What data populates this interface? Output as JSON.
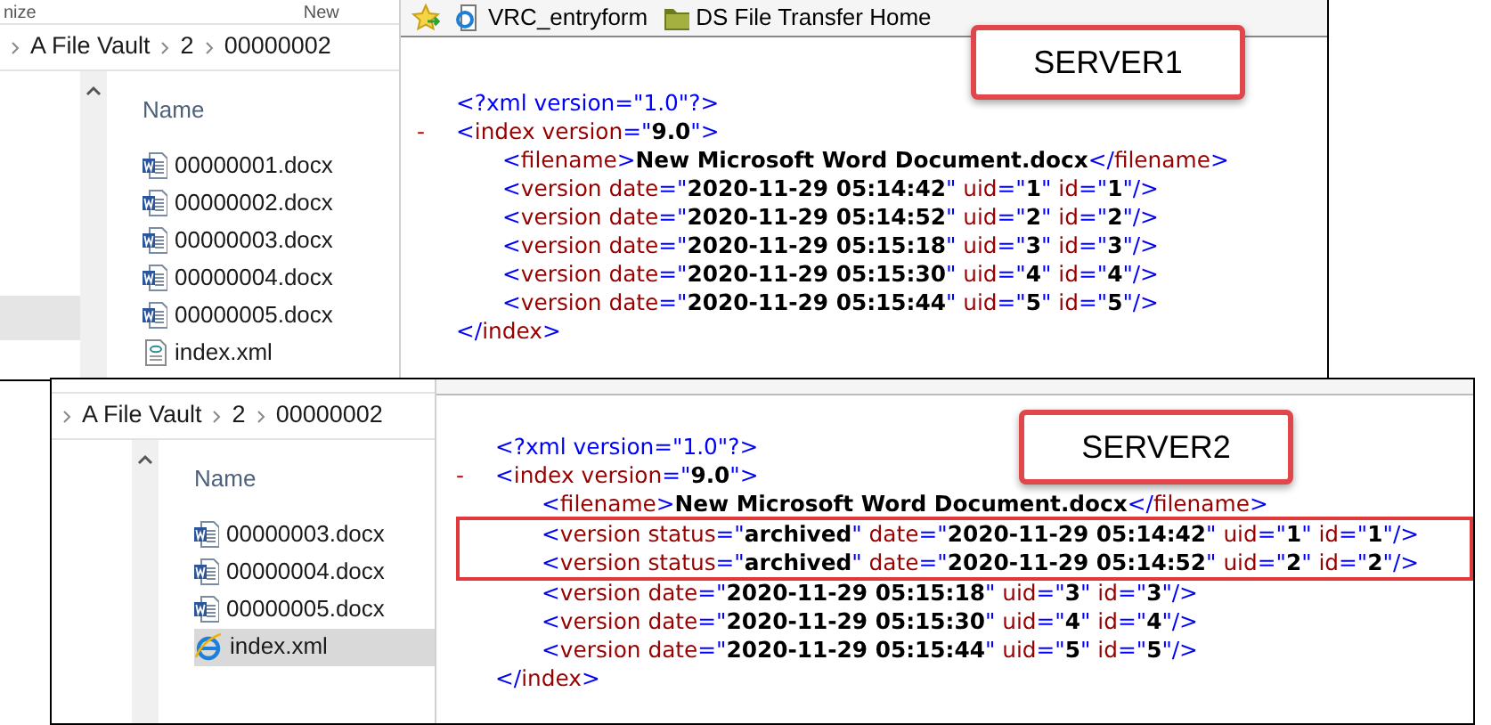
{
  "windows": [
    {
      "label": "SERVER1",
      "explorer": {
        "ribbon": [
          "nize",
          "New"
        ],
        "breadcrumb": [
          "A File Vault",
          "2",
          "00000002"
        ],
        "column": "Name",
        "files": [
          {
            "name": "00000001.docx",
            "kind": "word",
            "selected": false
          },
          {
            "name": "00000002.docx",
            "kind": "word",
            "selected": false
          },
          {
            "name": "00000003.docx",
            "kind": "word",
            "selected": false
          },
          {
            "name": "00000004.docx",
            "kind": "word",
            "selected": false
          },
          {
            "name": "00000005.docx",
            "kind": "word",
            "selected": false
          },
          {
            "name": "index.xml",
            "kind": "xml",
            "selected": false
          }
        ]
      },
      "favorites": [
        {
          "label": "VRC_entryform",
          "kind": "page"
        },
        {
          "label": "DS File Transfer Home",
          "kind": "folder"
        }
      ],
      "xml": [
        {
          "segments": [
            {
              "kind": "punct",
              "text": "<?"
            },
            {
              "kind": "punct",
              "text": "xml version=\"1.0\""
            },
            {
              "kind": "punct",
              "text": "?>"
            }
          ]
        },
        {
          "toggle": "-",
          "segments": [
            {
              "kind": "punct",
              "text": "<"
            },
            {
              "kind": "tag",
              "text": "index "
            },
            {
              "kind": "attr",
              "text": "version"
            },
            {
              "kind": "punct",
              "text": "=\""
            },
            {
              "kind": "value",
              "text": "9.0"
            },
            {
              "kind": "punct",
              "text": "\">"
            }
          ],
          "children": [
            {
              "segments": [
                {
                  "kind": "punct",
                  "text": "<"
                },
                {
                  "kind": "tag",
                  "text": "filename"
                },
                {
                  "kind": "punct",
                  "text": ">"
                },
                {
                  "kind": "value",
                  "text": "New Microsoft Word Document.docx"
                },
                {
                  "kind": "punct",
                  "text": "</"
                },
                {
                  "kind": "tag",
                  "text": "filename"
                },
                {
                  "kind": "punct",
                  "text": ">"
                }
              ],
              "highlighted": false
            },
            {
              "segments": [
                {
                  "kind": "punct",
                  "text": "<"
                },
                {
                  "kind": "tag",
                  "text": "version "
                },
                {
                  "kind": "attr",
                  "text": "date"
                },
                {
                  "kind": "punct",
                  "text": "=\""
                },
                {
                  "kind": "value",
                  "text": "2020-11-29 05:14:42"
                },
                {
                  "kind": "punct",
                  "text": "\" "
                },
                {
                  "kind": "attr",
                  "text": "uid"
                },
                {
                  "kind": "punct",
                  "text": "=\""
                },
                {
                  "kind": "value",
                  "text": "1"
                },
                {
                  "kind": "punct",
                  "text": "\" "
                },
                {
                  "kind": "attr",
                  "text": "id"
                },
                {
                  "kind": "punct",
                  "text": "=\""
                },
                {
                  "kind": "value",
                  "text": "1"
                },
                {
                  "kind": "punct",
                  "text": "\"/>"
                }
              ],
              "highlighted": false
            },
            {
              "segments": [
                {
                  "kind": "punct",
                  "text": "<"
                },
                {
                  "kind": "tag",
                  "text": "version "
                },
                {
                  "kind": "attr",
                  "text": "date"
                },
                {
                  "kind": "punct",
                  "text": "=\""
                },
                {
                  "kind": "value",
                  "text": "2020-11-29 05:14:52"
                },
                {
                  "kind": "punct",
                  "text": "\" "
                },
                {
                  "kind": "attr",
                  "text": "uid"
                },
                {
                  "kind": "punct",
                  "text": "=\""
                },
                {
                  "kind": "value",
                  "text": "2"
                },
                {
                  "kind": "punct",
                  "text": "\" "
                },
                {
                  "kind": "attr",
                  "text": "id"
                },
                {
                  "kind": "punct",
                  "text": "=\""
                },
                {
                  "kind": "value",
                  "text": "2"
                },
                {
                  "kind": "punct",
                  "text": "\"/>"
                }
              ],
              "highlighted": false
            },
            {
              "segments": [
                {
                  "kind": "punct",
                  "text": "<"
                },
                {
                  "kind": "tag",
                  "text": "version "
                },
                {
                  "kind": "attr",
                  "text": "date"
                },
                {
                  "kind": "punct",
                  "text": "=\""
                },
                {
                  "kind": "value",
                  "text": "2020-11-29 05:15:18"
                },
                {
                  "kind": "punct",
                  "text": "\" "
                },
                {
                  "kind": "attr",
                  "text": "uid"
                },
                {
                  "kind": "punct",
                  "text": "=\""
                },
                {
                  "kind": "value",
                  "text": "3"
                },
                {
                  "kind": "punct",
                  "text": "\" "
                },
                {
                  "kind": "attr",
                  "text": "id"
                },
                {
                  "kind": "punct",
                  "text": "=\""
                },
                {
                  "kind": "value",
                  "text": "3"
                },
                {
                  "kind": "punct",
                  "text": "\"/>"
                }
              ],
              "highlighted": false
            },
            {
              "segments": [
                {
                  "kind": "punct",
                  "text": "<"
                },
                {
                  "kind": "tag",
                  "text": "version "
                },
                {
                  "kind": "attr",
                  "text": "date"
                },
                {
                  "kind": "punct",
                  "text": "=\""
                },
                {
                  "kind": "value",
                  "text": "2020-11-29 05:15:30"
                },
                {
                  "kind": "punct",
                  "text": "\" "
                },
                {
                  "kind": "attr",
                  "text": "uid"
                },
                {
                  "kind": "punct",
                  "text": "=\""
                },
                {
                  "kind": "value",
                  "text": "4"
                },
                {
                  "kind": "punct",
                  "text": "\" "
                },
                {
                  "kind": "attr",
                  "text": "id"
                },
                {
                  "kind": "punct",
                  "text": "=\""
                },
                {
                  "kind": "value",
                  "text": "4"
                },
                {
                  "kind": "punct",
                  "text": "\"/>"
                }
              ],
              "highlighted": false
            },
            {
              "segments": [
                {
                  "kind": "punct",
                  "text": "<"
                },
                {
                  "kind": "tag",
                  "text": "version "
                },
                {
                  "kind": "attr",
                  "text": "date"
                },
                {
                  "kind": "punct",
                  "text": "=\""
                },
                {
                  "kind": "value",
                  "text": "2020-11-29 05:15:44"
                },
                {
                  "kind": "punct",
                  "text": "\" "
                },
                {
                  "kind": "attr",
                  "text": "uid"
                },
                {
                  "kind": "punct",
                  "text": "=\""
                },
                {
                  "kind": "value",
                  "text": "5"
                },
                {
                  "kind": "punct",
                  "text": "\" "
                },
                {
                  "kind": "attr",
                  "text": "id"
                },
                {
                  "kind": "punct",
                  "text": "=\""
                },
                {
                  "kind": "value",
                  "text": "5"
                },
                {
                  "kind": "punct",
                  "text": "\"/>"
                }
              ],
              "highlighted": false
            }
          ]
        },
        {
          "segments": [
            {
              "kind": "punct",
              "text": "</"
            },
            {
              "kind": "tag",
              "text": "index"
            },
            {
              "kind": "punct",
              "text": ">"
            }
          ]
        }
      ]
    },
    {
      "label": "SERVER2",
      "explorer": {
        "breadcrumb": [
          "A File Vault",
          "2",
          "00000002"
        ],
        "column": "Name",
        "files": [
          {
            "name": "00000003.docx",
            "kind": "word",
            "selected": false
          },
          {
            "name": "00000004.docx",
            "kind": "word",
            "selected": false
          },
          {
            "name": "00000005.docx",
            "kind": "word",
            "selected": false
          },
          {
            "name": "index.xml",
            "kind": "ie",
            "selected": true
          }
        ]
      },
      "xml": [
        {
          "segments": [
            {
              "kind": "punct",
              "text": "<?"
            },
            {
              "kind": "punct",
              "text": "xml version=\"1.0\""
            },
            {
              "kind": "punct",
              "text": "?>"
            }
          ]
        },
        {
          "toggle": "-",
          "segments": [
            {
              "kind": "punct",
              "text": "<"
            },
            {
              "kind": "tag",
              "text": "index "
            },
            {
              "kind": "attr",
              "text": "version"
            },
            {
              "kind": "punct",
              "text": "=\""
            },
            {
              "kind": "value",
              "text": "9.0"
            },
            {
              "kind": "punct",
              "text": "\">"
            }
          ],
          "children": [
            {
              "segments": [
                {
                  "kind": "punct",
                  "text": "<"
                },
                {
                  "kind": "tag",
                  "text": "filename"
                },
                {
                  "kind": "punct",
                  "text": ">"
                },
                {
                  "kind": "value",
                  "text": "New Microsoft Word Document.docx"
                },
                {
                  "kind": "punct",
                  "text": "</"
                },
                {
                  "kind": "tag",
                  "text": "filename"
                },
                {
                  "kind": "punct",
                  "text": ">"
                }
              ],
              "highlighted": false
            },
            {
              "segments": [
                {
                  "kind": "punct",
                  "text": "<"
                },
                {
                  "kind": "tag",
                  "text": "version "
                },
                {
                  "kind": "attr",
                  "text": "status"
                },
                {
                  "kind": "punct",
                  "text": "=\""
                },
                {
                  "kind": "value",
                  "text": "archived"
                },
                {
                  "kind": "punct",
                  "text": "\" "
                },
                {
                  "kind": "attr",
                  "text": "date"
                },
                {
                  "kind": "punct",
                  "text": "=\""
                },
                {
                  "kind": "value",
                  "text": "2020-11-29 05:14:42"
                },
                {
                  "kind": "punct",
                  "text": "\" "
                },
                {
                  "kind": "attr",
                  "text": "uid"
                },
                {
                  "kind": "punct",
                  "text": "=\""
                },
                {
                  "kind": "value",
                  "text": "1"
                },
                {
                  "kind": "punct",
                  "text": "\" "
                },
                {
                  "kind": "attr",
                  "text": "id"
                },
                {
                  "kind": "punct",
                  "text": "=\""
                },
                {
                  "kind": "value",
                  "text": "1"
                },
                {
                  "kind": "punct",
                  "text": "\"/>"
                }
              ],
              "highlighted": true
            },
            {
              "segments": [
                {
                  "kind": "punct",
                  "text": "<"
                },
                {
                  "kind": "tag",
                  "text": "version "
                },
                {
                  "kind": "attr",
                  "text": "status"
                },
                {
                  "kind": "punct",
                  "text": "=\""
                },
                {
                  "kind": "value",
                  "text": "archived"
                },
                {
                  "kind": "punct",
                  "text": "\" "
                },
                {
                  "kind": "attr",
                  "text": "date"
                },
                {
                  "kind": "punct",
                  "text": "=\""
                },
                {
                  "kind": "value",
                  "text": "2020-11-29 05:14:52"
                },
                {
                  "kind": "punct",
                  "text": "\" "
                },
                {
                  "kind": "attr",
                  "text": "uid"
                },
                {
                  "kind": "punct",
                  "text": "=\""
                },
                {
                  "kind": "value",
                  "text": "2"
                },
                {
                  "kind": "punct",
                  "text": "\" "
                },
                {
                  "kind": "attr",
                  "text": "id"
                },
                {
                  "kind": "punct",
                  "text": "=\""
                },
                {
                  "kind": "value",
                  "text": "2"
                },
                {
                  "kind": "punct",
                  "text": "\"/>"
                }
              ],
              "highlighted": true
            },
            {
              "segments": [
                {
                  "kind": "punct",
                  "text": "<"
                },
                {
                  "kind": "tag",
                  "text": "version "
                },
                {
                  "kind": "attr",
                  "text": "date"
                },
                {
                  "kind": "punct",
                  "text": "=\""
                },
                {
                  "kind": "value",
                  "text": "2020-11-29 05:15:18"
                },
                {
                  "kind": "punct",
                  "text": "\" "
                },
                {
                  "kind": "attr",
                  "text": "uid"
                },
                {
                  "kind": "punct",
                  "text": "=\""
                },
                {
                  "kind": "value",
                  "text": "3"
                },
                {
                  "kind": "punct",
                  "text": "\" "
                },
                {
                  "kind": "attr",
                  "text": "id"
                },
                {
                  "kind": "punct",
                  "text": "=\""
                },
                {
                  "kind": "value",
                  "text": "3"
                },
                {
                  "kind": "punct",
                  "text": "\"/>"
                }
              ],
              "highlighted": false
            },
            {
              "segments": [
                {
                  "kind": "punct",
                  "text": "<"
                },
                {
                  "kind": "tag",
                  "text": "version "
                },
                {
                  "kind": "attr",
                  "text": "date"
                },
                {
                  "kind": "punct",
                  "text": "=\""
                },
                {
                  "kind": "value",
                  "text": "2020-11-29 05:15:30"
                },
                {
                  "kind": "punct",
                  "text": "\" "
                },
                {
                  "kind": "attr",
                  "text": "uid"
                },
                {
                  "kind": "punct",
                  "text": "=\""
                },
                {
                  "kind": "value",
                  "text": "4"
                },
                {
                  "kind": "punct",
                  "text": "\" "
                },
                {
                  "kind": "attr",
                  "text": "id"
                },
                {
                  "kind": "punct",
                  "text": "=\""
                },
                {
                  "kind": "value",
                  "text": "4"
                },
                {
                  "kind": "punct",
                  "text": "\"/>"
                }
              ],
              "highlighted": false
            },
            {
              "segments": [
                {
                  "kind": "punct",
                  "text": "<"
                },
                {
                  "kind": "tag",
                  "text": "version "
                },
                {
                  "kind": "attr",
                  "text": "date"
                },
                {
                  "kind": "punct",
                  "text": "=\""
                },
                {
                  "kind": "value",
                  "text": "2020-11-29 05:15:44"
                },
                {
                  "kind": "punct",
                  "text": "\" "
                },
                {
                  "kind": "attr",
                  "text": "uid"
                },
                {
                  "kind": "punct",
                  "text": "=\""
                },
                {
                  "kind": "value",
                  "text": "5"
                },
                {
                  "kind": "punct",
                  "text": "\" "
                },
                {
                  "kind": "attr",
                  "text": "id"
                },
                {
                  "kind": "punct",
                  "text": "=\""
                },
                {
                  "kind": "value",
                  "text": "5"
                },
                {
                  "kind": "punct",
                  "text": "\"/>"
                }
              ],
              "highlighted": false
            }
          ]
        },
        {
          "segments": [
            {
              "kind": "punct",
              "text": "</"
            },
            {
              "kind": "tag",
              "text": "index"
            },
            {
              "kind": "punct",
              "text": ">"
            }
          ]
        }
      ]
    }
  ]
}
